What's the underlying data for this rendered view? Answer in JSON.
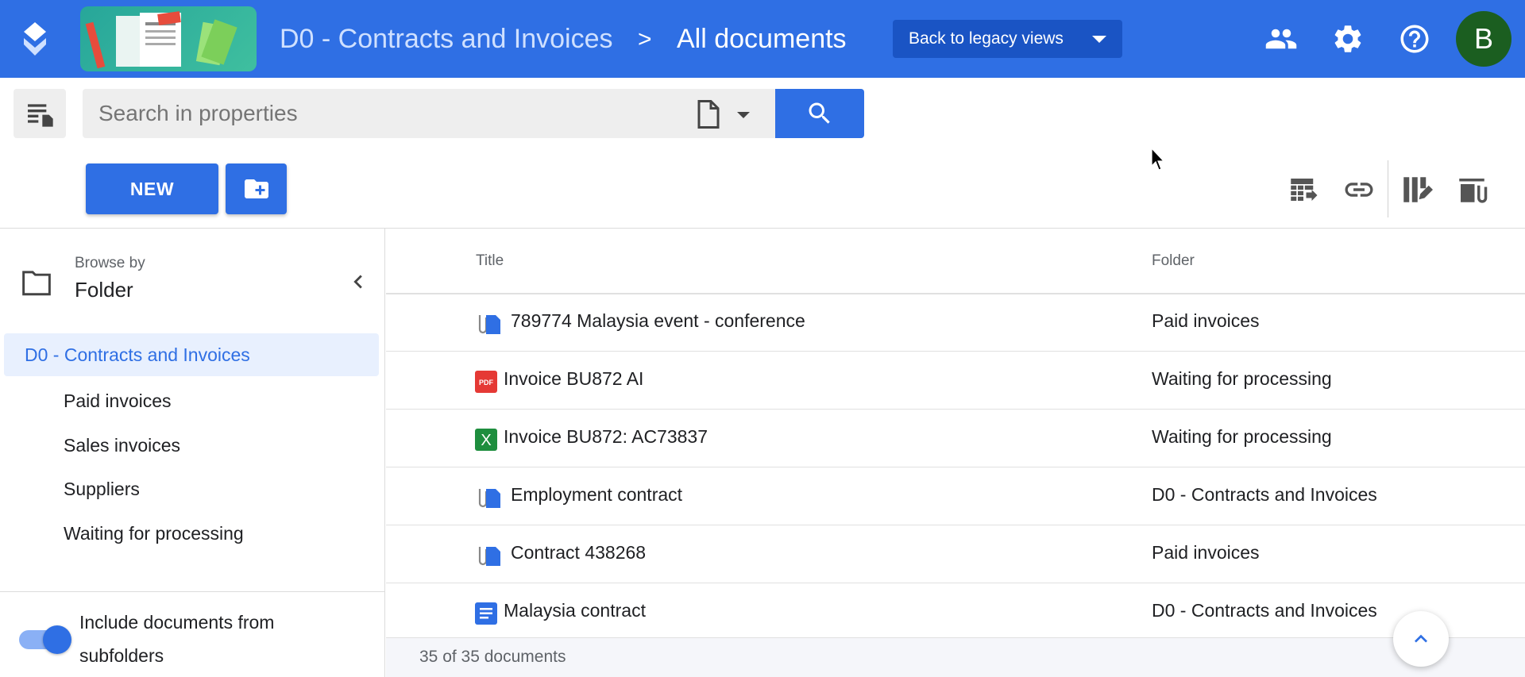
{
  "header": {
    "repository": "D0 - Contracts and Invoices",
    "separator": ">",
    "current_view": "All documents",
    "legacy_button": "Back to legacy views",
    "avatar_initial": "B",
    "bar_color": "#2f6fe4",
    "icons": [
      "users-icon",
      "gear-icon",
      "help-icon"
    ]
  },
  "search": {
    "placeholder": "Search in properties",
    "value": "",
    "doctype_icon": "document-icon"
  },
  "actions": {
    "new_label": "NEW",
    "new_folder_icon": "folder-add-icon",
    "tools": [
      "table-export-icon",
      "link-icon",
      "edit-columns-icon",
      "attachments-icon"
    ]
  },
  "sidebar": {
    "browse_by_label": "Browse by",
    "browse_by_value": "Folder",
    "root": "D0 - Contracts and Invoices",
    "items": [
      {
        "label": "Paid invoices"
      },
      {
        "label": "Sales invoices"
      },
      {
        "label": "Suppliers"
      },
      {
        "label": "Waiting for processing"
      }
    ],
    "include_subfolders_label": "Include documents from subfolders",
    "include_subfolders": true
  },
  "table": {
    "columns": {
      "title": "Title",
      "folder": "Folder"
    },
    "rows": [
      {
        "icon": "attachment-document-icon",
        "title": "789774 Malaysia event - conference",
        "folder": "Paid invoices"
      },
      {
        "icon": "pdf-icon",
        "title": "Invoice BU872 AI",
        "folder": "Waiting for processing"
      },
      {
        "icon": "excel-icon",
        "title": "Invoice BU872: AC73837",
        "folder": "Waiting for processing"
      },
      {
        "icon": "attachment-document-icon",
        "title": "Employment contract",
        "folder": "D0 - Contracts and Invoices"
      },
      {
        "icon": "attachment-document-icon",
        "title": "Contract 438268",
        "folder": "Paid invoices"
      },
      {
        "icon": "text-document-icon",
        "title": "Malaysia contract",
        "folder": "D0 - Contracts and Invoices"
      }
    ],
    "count_text": "35 of 35 documents"
  }
}
